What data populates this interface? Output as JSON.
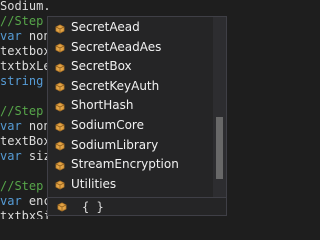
{
  "code": {
    "lines": [
      {
        "parts": [
          {
            "text": "Sodium.",
            "kind": "plain"
          }
        ]
      },
      {
        "parts": [
          {
            "text": "//Step ",
            "kind": "comment"
          }
        ]
      },
      {
        "parts": [
          {
            "text": "var ",
            "kind": "keyword"
          },
          {
            "text": "non",
            "kind": "plain"
          }
        ]
      },
      {
        "parts": [
          {
            "text": "textbox",
            "kind": "plain"
          }
        ]
      },
      {
        "parts": [
          {
            "text": "txtbxLe",
            "kind": "plain"
          }
        ]
      },
      {
        "parts": [
          {
            "text": "string ",
            "kind": "keyword"
          }
        ]
      },
      {
        "parts": [
          {
            "text": "",
            "kind": "plain"
          }
        ]
      },
      {
        "parts": [
          {
            "text": "//Step ",
            "kind": "comment"
          }
        ]
      },
      {
        "parts": [
          {
            "text": "var ",
            "kind": "keyword"
          },
          {
            "text": "non",
            "kind": "plain"
          }
        ]
      },
      {
        "parts": [
          {
            "text": "textBox",
            "kind": "plain"
          }
        ]
      },
      {
        "parts": [
          {
            "text": "var ",
            "kind": "keyword"
          },
          {
            "text": "siz",
            "kind": "plain"
          }
        ]
      },
      {
        "parts": [
          {
            "text": "",
            "kind": "plain"
          }
        ]
      },
      {
        "parts": [
          {
            "text": "//Step ",
            "kind": "comment"
          }
        ]
      },
      {
        "parts": [
          {
            "text": "var ",
            "kind": "keyword"
          },
          {
            "text": "enc",
            "kind": "plain"
          }
        ]
      },
      {
        "parts": [
          {
            "text": "txtbxSi",
            "kind": "plain"
          }
        ]
      }
    ]
  },
  "completion": {
    "items": [
      {
        "label": "SecretAead",
        "icon": "class-icon"
      },
      {
        "label": "SecretAeadAes",
        "icon": "class-icon"
      },
      {
        "label": "SecretBox",
        "icon": "class-icon"
      },
      {
        "label": "SecretKeyAuth",
        "icon": "class-icon"
      },
      {
        "label": "ShortHash",
        "icon": "class-icon"
      },
      {
        "label": "SodiumCore",
        "icon": "class-icon"
      },
      {
        "label": "SodiumLibrary",
        "icon": "class-icon"
      },
      {
        "label": "StreamEncryption",
        "icon": "class-icon"
      },
      {
        "label": "Utilities",
        "icon": "class-icon"
      }
    ],
    "filter": {
      "icon": "class-filter-icon",
      "braces": "{ }"
    },
    "scroll_position": 0.55
  },
  "colors": {
    "class_icon": "#e2a345",
    "comment": "#57a64a",
    "keyword": "#569cd6"
  }
}
